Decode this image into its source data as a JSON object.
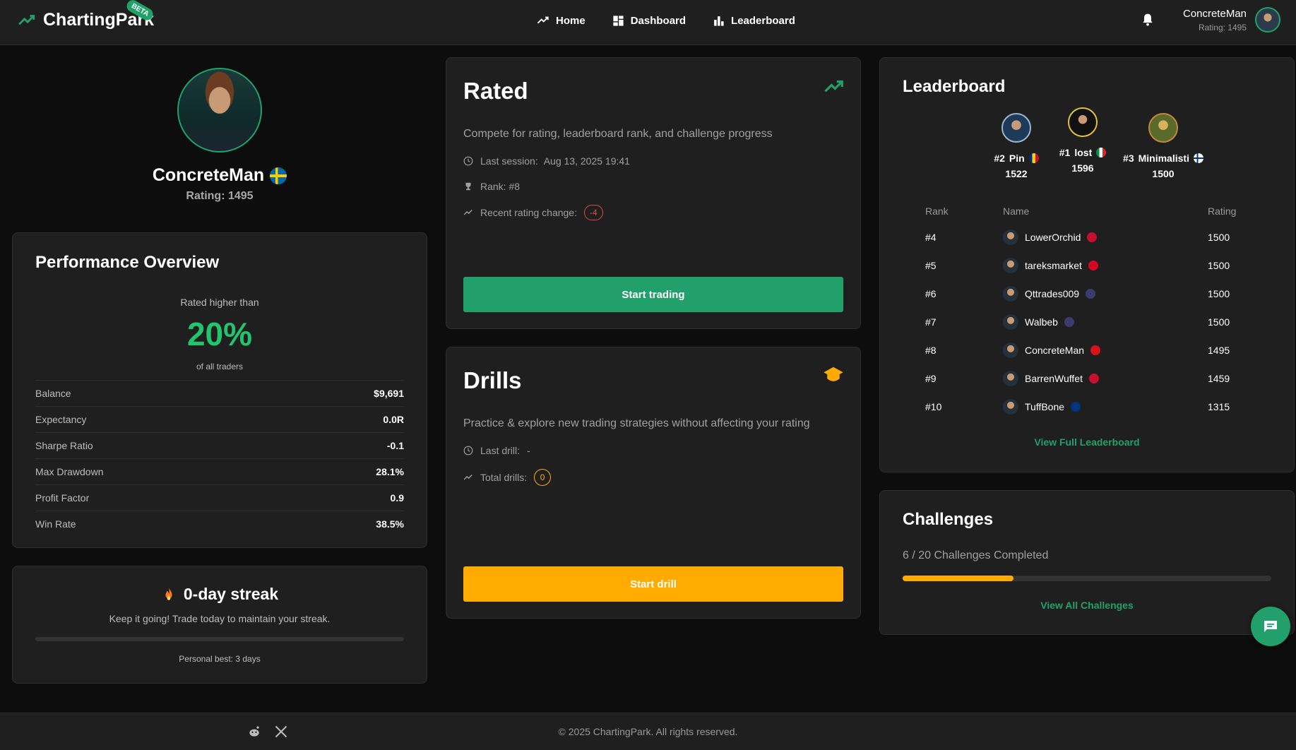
{
  "brand": {
    "name": "ChartingPark",
    "badge": "BETA"
  },
  "nav": [
    {
      "label": "Home",
      "icon": "trend-icon"
    },
    {
      "label": "Dashboard",
      "icon": "dashboard-icon"
    },
    {
      "label": "Leaderboard",
      "icon": "bar-chart-icon"
    }
  ],
  "header_user": {
    "name": "ConcreteMan",
    "rating": "Rating: 1495"
  },
  "profile": {
    "name": "ConcreteMan",
    "rating": "Rating: 1495",
    "flag": "se"
  },
  "performance": {
    "title": "Performance Overview",
    "rated_higher_label": "Rated higher than",
    "percent": "20%",
    "of_all": "of all traders",
    "rows": [
      {
        "label": "Balance",
        "value": "$9,691"
      },
      {
        "label": "Expectancy",
        "value": "0.0R"
      },
      {
        "label": "Sharpe Ratio",
        "value": "-0.1"
      },
      {
        "label": "Max Drawdown",
        "value": "28.1%"
      },
      {
        "label": "Profit Factor",
        "value": "0.9"
      },
      {
        "label": "Win Rate",
        "value": "38.5%"
      }
    ]
  },
  "streak": {
    "title": "0-day streak",
    "subtitle": "Keep it going! Trade today to maintain your streak.",
    "best": "Personal best: 3 days",
    "progress": 0
  },
  "rated": {
    "title": "Rated",
    "description": "Compete for rating, leaderboard rank, and challenge progress",
    "last_session_label": "Last session:",
    "last_session_value": "Aug 13, 2025 19:41",
    "rank": "Rank: #8",
    "recent_change_label": "Recent rating change:",
    "recent_change_value": "-4",
    "button": "Start trading"
  },
  "drills": {
    "title": "Drills",
    "description": "Practice & explore new trading strategies without affecting your rating",
    "last_drill_label": "Last drill:",
    "last_drill_value": "-",
    "total_label": "Total drills:",
    "total_value": "0",
    "button": "Start drill"
  },
  "leaderboard": {
    "title": "Leaderboard",
    "podium": [
      {
        "rank": "#2",
        "name": "Pin",
        "rating": "1522"
      },
      {
        "rank": "#1",
        "name": "lost",
        "rating": "1596"
      },
      {
        "rank": "#3",
        "name": "Minimalisti",
        "rating": "1500"
      }
    ],
    "headers": {
      "rank": "Rank",
      "name": "Name",
      "rating": "Rating"
    },
    "rows": [
      {
        "rank": "#4",
        "name": "LowerOrchid",
        "rating": "1500",
        "flag_color": "#c8102e"
      },
      {
        "rank": "#5",
        "name": "tareksmarket",
        "rating": "1500",
        "flag_color": "#d80621"
      },
      {
        "rank": "#6",
        "name": "Qttrades009",
        "rating": "1500",
        "flag_color": "#3c3b6e"
      },
      {
        "rank": "#7",
        "name": "Walbeb",
        "rating": "1500",
        "flag_color": "#3c3b6e"
      },
      {
        "rank": "#8",
        "name": "ConcreteMan",
        "rating": "1495",
        "flag_color": "#d7141a"
      },
      {
        "rank": "#9",
        "name": "BarrenWuffet",
        "rating": "1459",
        "flag_color": "#c8102e"
      },
      {
        "rank": "#10",
        "name": "TuffBone",
        "rating": "1315",
        "flag_color": "#003580"
      }
    ],
    "view_full": "View Full Leaderboard"
  },
  "challenges": {
    "title": "Challenges",
    "progress_text": "6 / 20 Challenges Completed",
    "progress": 0.3,
    "view_all": "View All Challenges"
  },
  "footer": {
    "copyright": "© 2025 ChartingPark. All rights reserved."
  },
  "colors": {
    "accent": "#21a06c",
    "warning": "#ffab00",
    "danger": "#e04848"
  }
}
